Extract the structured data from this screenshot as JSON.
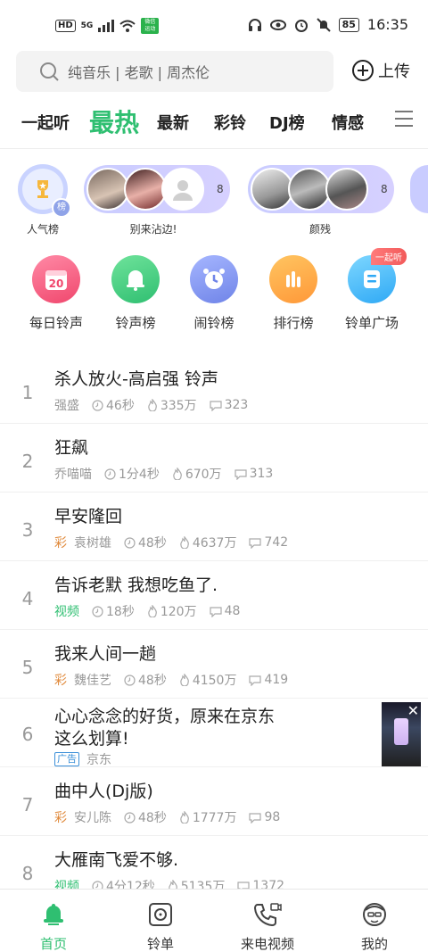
{
  "status_bar": {
    "left": {
      "hd": "HD",
      "network": "5G",
      "wechat_line1": "微信",
      "wechat_line2": "运动"
    },
    "right": {
      "battery": "85",
      "time": "16:35"
    },
    "icons": [
      "headphone-icon",
      "eye-icon",
      "alarm-icon",
      "mute-icon"
    ]
  },
  "search": {
    "placeholder": "纯音乐 | 老歌 | 周杰伦"
  },
  "header": {
    "upload_label": "上传"
  },
  "tabs": [
    {
      "label": "一起听"
    },
    {
      "label": "最热",
      "active": true
    },
    {
      "label": "最新"
    },
    {
      "label": "彩铃"
    },
    {
      "label": "DJ榜"
    },
    {
      "label": "情感"
    }
  ],
  "stories": [
    {
      "label": "人气榜",
      "badge": "榜"
    },
    {
      "label": "别来沾边!",
      "count": "8"
    },
    {
      "label": "颜残",
      "count": "8"
    }
  ],
  "features": [
    {
      "label": "每日铃声",
      "icon": "calendar-icon",
      "num": "20"
    },
    {
      "label": "铃声榜",
      "icon": "bell-icon"
    },
    {
      "label": "闹铃榜",
      "icon": "alarm-clock-icon"
    },
    {
      "label": "排行榜",
      "icon": "bars-icon"
    },
    {
      "label": "铃单广场",
      "icon": "playlist-icon",
      "tag": "一起听"
    }
  ],
  "songs": [
    {
      "rank": "1",
      "title": "杀人放火-高启强 铃声",
      "artist": "强盛",
      "duration": "46秒",
      "plays": "335万",
      "comments": "323"
    },
    {
      "rank": "2",
      "title": "狂飙",
      "artist": "乔喵喵",
      "duration": "1分4秒",
      "plays": "670万",
      "comments": "313"
    },
    {
      "rank": "3",
      "title": "早安隆回",
      "tag": "彩",
      "artist": "袁树雄",
      "duration": "48秒",
      "plays": "4637万",
      "comments": "742"
    },
    {
      "rank": "4",
      "title": "告诉老默 我想吃鱼了.",
      "tag": "视频",
      "duration": "18秒",
      "plays": "120万",
      "comments": "48"
    },
    {
      "rank": "5",
      "title": "我来人间一趟",
      "tag": "彩",
      "artist": "魏佳艺",
      "duration": "48秒",
      "plays": "4150万",
      "comments": "419"
    },
    {
      "rank": "6",
      "title_line1": "心心念念的好货，原来在京东",
      "title_line2": "这么划算!",
      "ad_tag": "广告",
      "advertiser": "京东"
    },
    {
      "rank": "7",
      "title": "曲中人(Dj版)",
      "tag": "彩",
      "artist": "安儿陈",
      "duration": "48秒",
      "plays": "1777万",
      "comments": "98"
    },
    {
      "rank": "8",
      "title": "大雁南飞爱不够.",
      "tag": "视频",
      "duration": "4分12秒",
      "plays": "5135万",
      "comments": "1372"
    }
  ],
  "bottom_nav": [
    {
      "label": "首页",
      "icon": "home-bell-icon",
      "active": true
    },
    {
      "label": "铃单",
      "icon": "disc-icon"
    },
    {
      "label": "来电视频",
      "icon": "phone-video-icon"
    },
    {
      "label": "我的",
      "icon": "profile-icon"
    }
  ],
  "colors": {
    "accent": "#2fbf71",
    "cai": "#e08a3c",
    "ad": "#3a8fd8"
  }
}
